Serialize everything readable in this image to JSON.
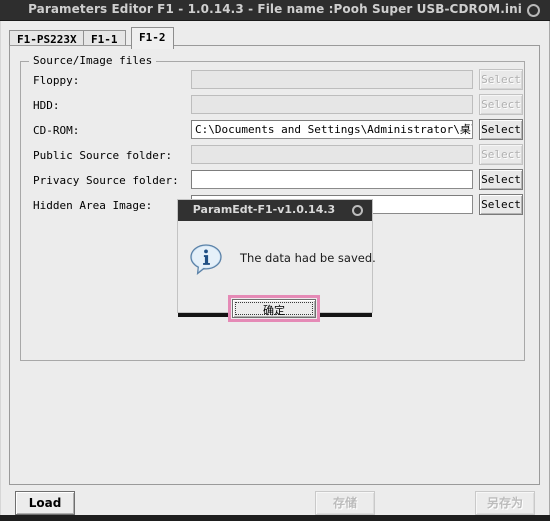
{
  "window": {
    "title": "Parameters Editor F1 - 1.0.14.3 - File name :Pooh Super USB-CDROM.ini",
    "round_icon": "circle-icon"
  },
  "tabs": [
    {
      "label": "F1-PS223X",
      "active": false
    },
    {
      "label": "F1-1",
      "active": false
    },
    {
      "label": "F1-2",
      "active": true
    }
  ],
  "group": {
    "legend": "Source/Image files",
    "rows": [
      {
        "label": "Floppy:",
        "value": "",
        "enabled": false,
        "button": "Select",
        "button_enabled": false
      },
      {
        "label": "HDD:",
        "value": "",
        "enabled": false,
        "button": "Select",
        "button_enabled": false
      },
      {
        "label": "CD-ROM:",
        "value": "C:\\Documents and Settings\\Administrator\\桌面\\Pooh",
        "enabled": true,
        "button": "Select",
        "button_enabled": true
      },
      {
        "label": "Public Source folder:",
        "value": "",
        "enabled": false,
        "button": "Select",
        "button_enabled": false
      },
      {
        "label": "Privacy Source folder:",
        "value": "",
        "enabled": true,
        "button": "Select",
        "button_enabled": true
      },
      {
        "label": "Hidden Area Image:",
        "value": "",
        "enabled": true,
        "button": "Select",
        "button_enabled": true
      }
    ]
  },
  "bottom": {
    "load": "Load",
    "save": "存储",
    "save_as": "另存为"
  },
  "dialog": {
    "title": "ParamEdt-F1-v1.0.14.3",
    "round_icon": "circle-icon",
    "icon": "info-icon",
    "message": "The data had be saved.",
    "ok_label": "确定",
    "highlight_color": "#e58ab6"
  }
}
